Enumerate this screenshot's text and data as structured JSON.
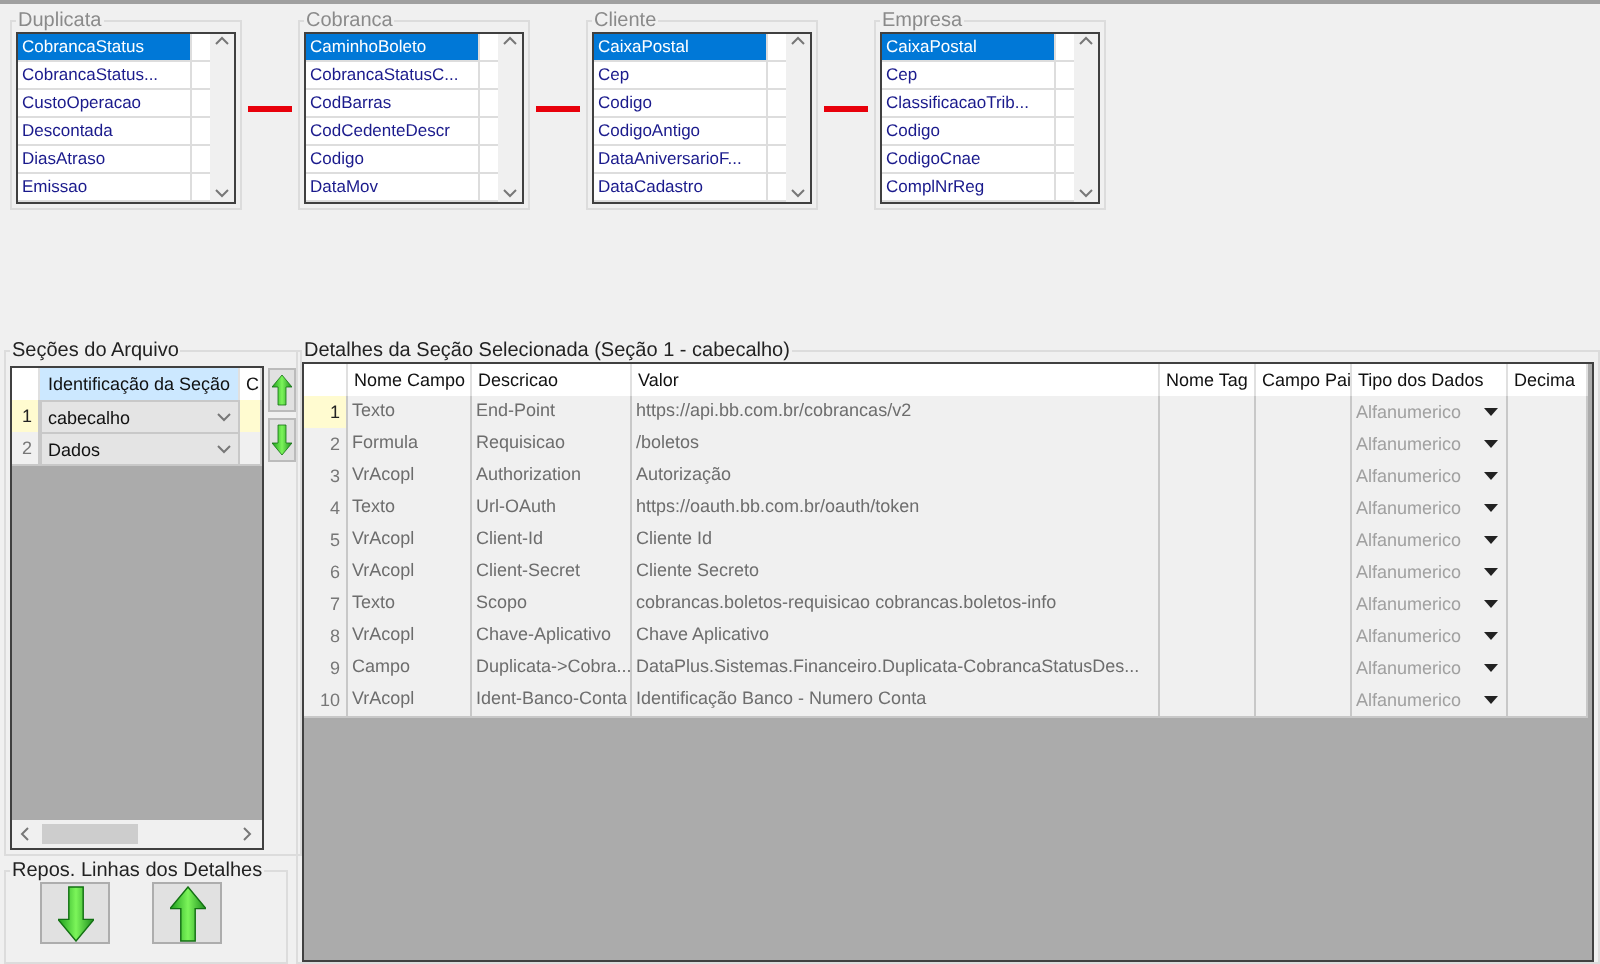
{
  "top_tables": [
    {
      "title": "Duplicata",
      "fields": [
        {
          "name": "CobrancaStatus",
          "selected": true
        },
        {
          "name": "CobrancaStatus...",
          "selected": false
        },
        {
          "name": "CustoOperacao",
          "selected": false
        },
        {
          "name": "Descontada",
          "selected": false
        },
        {
          "name": "DiasAtraso",
          "selected": false
        },
        {
          "name": "Emissao",
          "selected": false
        }
      ]
    },
    {
      "title": "Cobranca",
      "fields": [
        {
          "name": "CaminhoBoleto",
          "selected": true
        },
        {
          "name": "CobrancaStatusC...",
          "selected": false
        },
        {
          "name": "CodBarras",
          "selected": false
        },
        {
          "name": "CodCedenteDescr",
          "selected": false
        },
        {
          "name": "Codigo",
          "selected": false
        },
        {
          "name": "DataMov",
          "selected": false
        }
      ]
    },
    {
      "title": "Cliente",
      "fields": [
        {
          "name": "CaixaPostal",
          "selected": true
        },
        {
          "name": "Cep",
          "selected": false
        },
        {
          "name": "Codigo",
          "selected": false
        },
        {
          "name": "CodigoAntigo",
          "selected": false
        },
        {
          "name": "DataAniversarioF...",
          "selected": false
        },
        {
          "name": "DataCadastro",
          "selected": false
        }
      ]
    },
    {
      "title": "Empresa",
      "fields": [
        {
          "name": "CaixaPostal",
          "selected": true
        },
        {
          "name": "Cep",
          "selected": false
        },
        {
          "name": "ClassificacaoTrib...",
          "selected": false
        },
        {
          "name": "Codigo",
          "selected": false
        },
        {
          "name": "CodigoCnae",
          "selected": false
        },
        {
          "name": "ComplNrReg",
          "selected": false
        }
      ]
    }
  ],
  "sections_group": {
    "title": "Seções do Arquivo",
    "columns": [
      "Identificação da Seção",
      "C"
    ],
    "rows": [
      {
        "number": "1",
        "section": "cabecalho",
        "selected": true
      },
      {
        "number": "2",
        "section": "Dados",
        "selected": false
      }
    ]
  },
  "reorder_group": {
    "title": "Repos. Linhas dos Detalhes"
  },
  "details_group": {
    "title": "Detalhes da Seção Selecionada (Seção 1 - cabecalho)",
    "columns": [
      "Nome Campo",
      "Descricao",
      "Valor",
      "Nome Tag",
      "Campo Pai",
      "Tipo dos Dados",
      "Decima"
    ],
    "rows": [
      {
        "number": "1",
        "nome_campo": "Texto",
        "descricao": "End-Point",
        "valor": "https://api.bb.com.br/cobrancas/v2",
        "tipo_dados": "Alfanumerico",
        "selected": true
      },
      {
        "number": "2",
        "nome_campo": "Formula",
        "descricao": "Requisicao",
        "valor": "/boletos",
        "tipo_dados": "Alfanumerico",
        "selected": false
      },
      {
        "number": "3",
        "nome_campo": "VrAcopl",
        "descricao": "Authorization",
        "valor": "Autorização",
        "tipo_dados": "Alfanumerico",
        "selected": false
      },
      {
        "number": "4",
        "nome_campo": "Texto",
        "descricao": "Url-OAuth",
        "valor": "https://oauth.bb.com.br/oauth/token",
        "tipo_dados": "Alfanumerico",
        "selected": false
      },
      {
        "number": "5",
        "nome_campo": "VrAcopl",
        "descricao": "Client-Id",
        "valor": "Cliente Id",
        "tipo_dados": "Alfanumerico",
        "selected": false
      },
      {
        "number": "6",
        "nome_campo": "VrAcopl",
        "descricao": "Client-Secret",
        "valor": "Cliente Secreto",
        "tipo_dados": "Alfanumerico",
        "selected": false
      },
      {
        "number": "7",
        "nome_campo": "Texto",
        "descricao": "Scopo",
        "valor": "cobrancas.boletos-requisicao cobrancas.boletos-info",
        "tipo_dados": "Alfanumerico",
        "selected": false
      },
      {
        "number": "8",
        "nome_campo": "VrAcopl",
        "descricao": "Chave-Aplicativo",
        "valor": "Chave Aplicativo",
        "tipo_dados": "Alfanumerico",
        "selected": false
      },
      {
        "number": "9",
        "nome_campo": "Campo",
        "descricao": "Duplicata->Cobra...",
        "valor": "DataPlus.Sistemas.Financeiro.Duplicata-CobrancaStatusDes...",
        "tipo_dados": "Alfanumerico",
        "selected": false
      },
      {
        "number": "10",
        "nome_campo": "VrAcopl",
        "descricao": "Ident-Banco-Conta",
        "valor": "Identificação Banco - Numero Conta",
        "tipo_dados": "Alfanumerico",
        "selected": false
      }
    ]
  }
}
